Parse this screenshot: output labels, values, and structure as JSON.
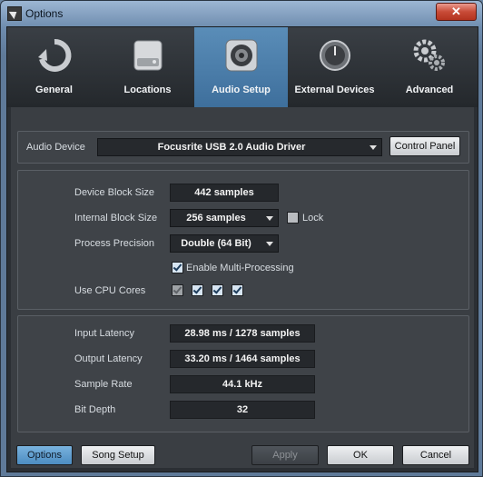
{
  "window": {
    "title": "Options",
    "close_label": "✕"
  },
  "tabs": [
    {
      "label": "General",
      "icon": "refresh-icon"
    },
    {
      "label": "Locations",
      "icon": "hard-drive-icon"
    },
    {
      "label": "Audio Setup",
      "icon": "speaker-icon",
      "active": true
    },
    {
      "label": "External Devices",
      "icon": "knob-icon"
    },
    {
      "label": "Advanced",
      "icon": "gears-icon"
    }
  ],
  "audio_device": {
    "label": "Audio Device",
    "value": "Focusrite USB 2.0 Audio Driver",
    "control_panel": "Control Panel"
  },
  "settings": {
    "device_block_size": {
      "label": "Device Block Size",
      "value": "442 samples"
    },
    "internal_block_size": {
      "label": "Internal Block Size",
      "value": "256 samples"
    },
    "lock": {
      "label": "Lock"
    },
    "process_precision": {
      "label": "Process Precision",
      "value": "Double (64 Bit)"
    },
    "multi_processing": {
      "label": "Enable Multi-Processing"
    },
    "cpu_cores": {
      "label": "Use CPU Cores"
    }
  },
  "info": {
    "input_latency": {
      "label": "Input Latency",
      "value": "28.98 ms / 1278 samples"
    },
    "output_latency": {
      "label": "Output Latency",
      "value": "33.20 ms / 1464 samples"
    },
    "sample_rate": {
      "label": "Sample Rate",
      "value": "44.1 kHz"
    },
    "bit_depth": {
      "label": "Bit Depth",
      "value": "32"
    }
  },
  "footer": {
    "options": "Options",
    "song_setup": "Song Setup",
    "apply": "Apply",
    "ok": "OK",
    "cancel": "Cancel"
  }
}
